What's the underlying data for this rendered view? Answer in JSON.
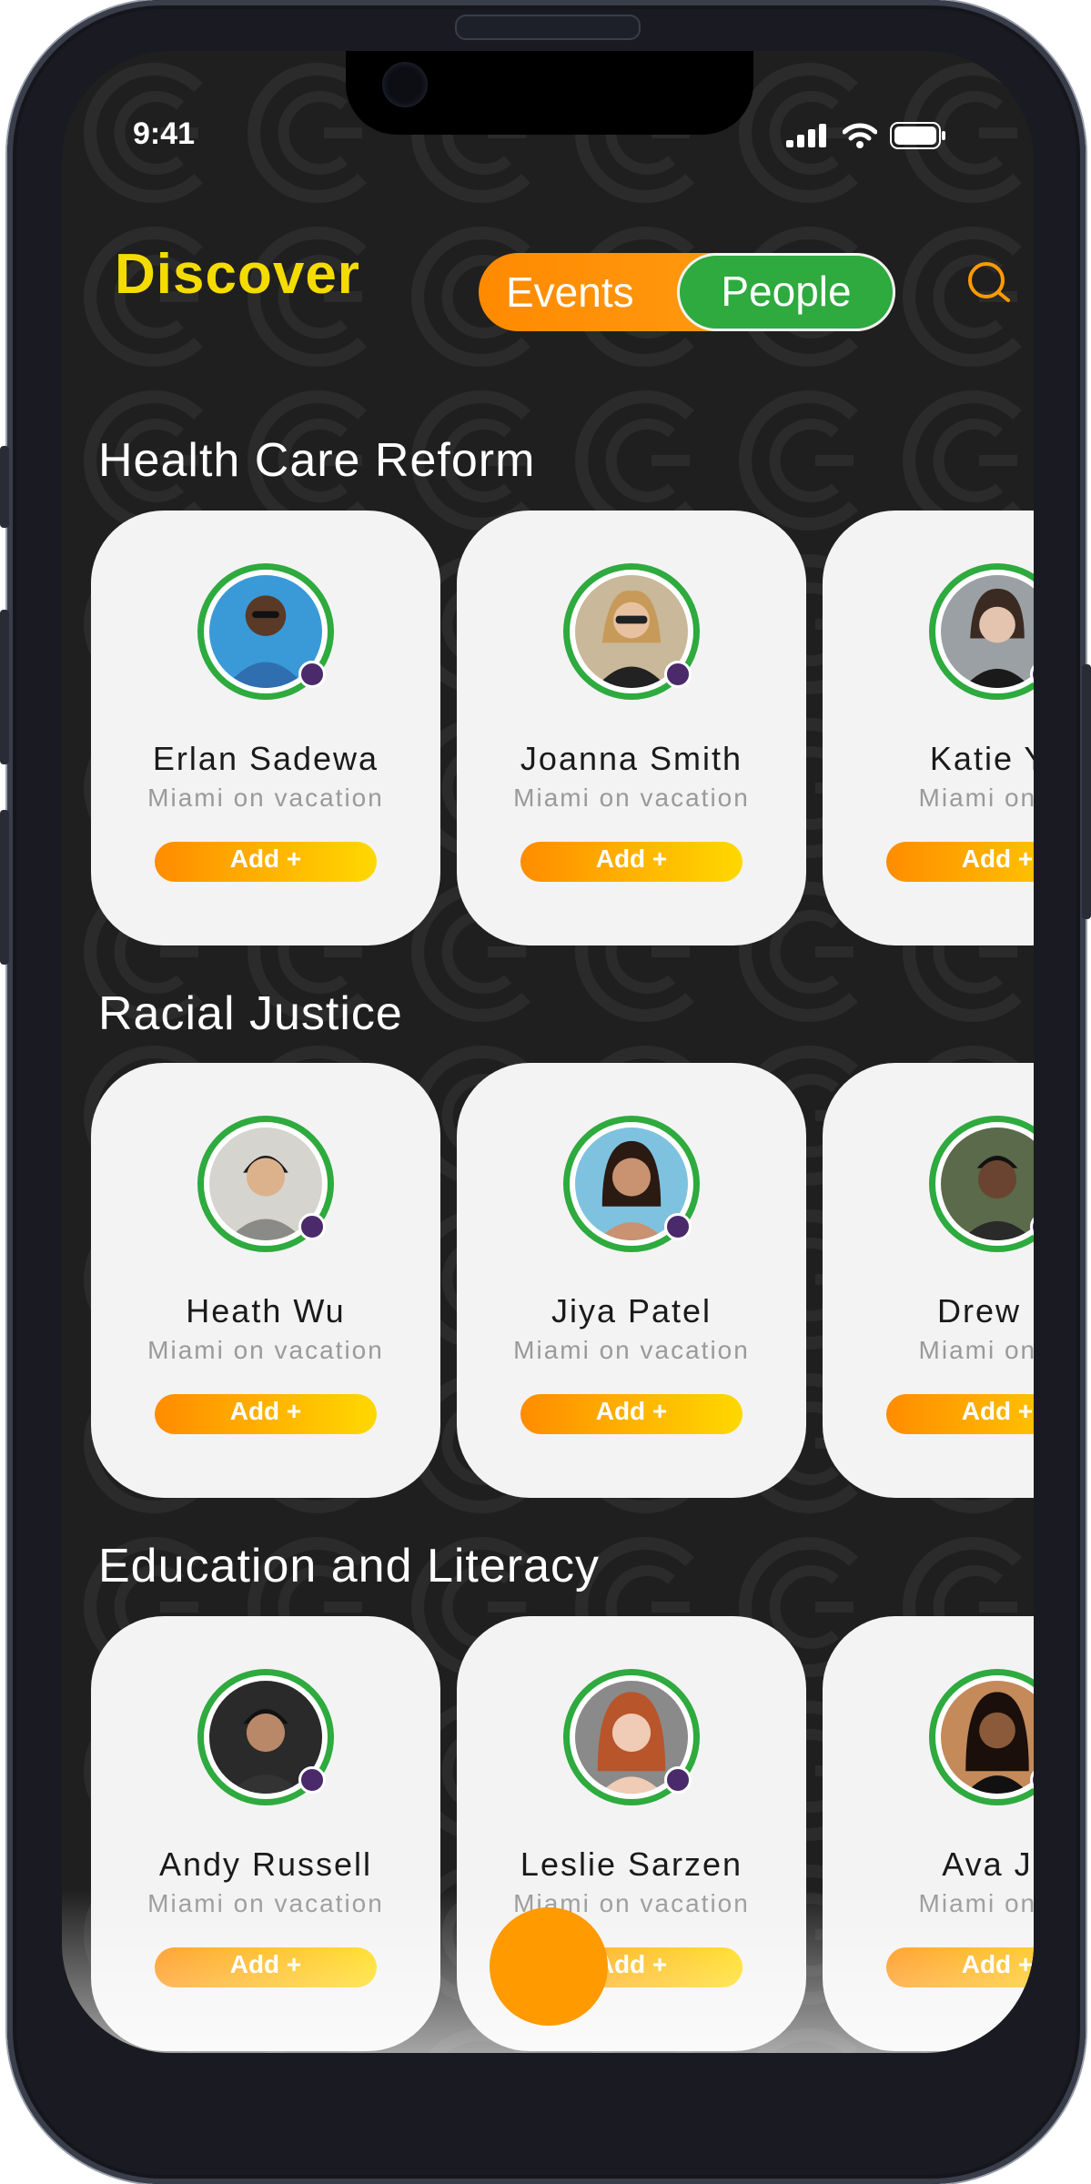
{
  "status": {
    "time": "9:41"
  },
  "header": {
    "title": "Discover",
    "tabs": [
      {
        "label": "Events",
        "active": false
      },
      {
        "label": "People",
        "active": true
      }
    ]
  },
  "sections": [
    {
      "title": "Health Care Reform",
      "people": [
        {
          "name": "Erlan Sadewa",
          "location": "Miami on vacation",
          "action": "Add +"
        },
        {
          "name": "Joanna Smith",
          "location": "Miami on vacation",
          "action": "Add +"
        },
        {
          "name": "Katie Yo",
          "location": "Miami on va",
          "action": "Add +"
        }
      ]
    },
    {
      "title": "Racial Justice",
      "people": [
        {
          "name": "Heath Wu",
          "location": "Miami on vacation",
          "action": "Add +"
        },
        {
          "name": "Jiya Patel",
          "location": "Miami on vacation",
          "action": "Add +"
        },
        {
          "name": "Drew R",
          "location": "Miami on va",
          "action": "Add +"
        }
      ]
    },
    {
      "title": "Education and Literacy",
      "people": [
        {
          "name": "Andy Russell",
          "location": "Miami on vacation",
          "action": "Add +"
        },
        {
          "name": "Leslie Sarzen",
          "location": "Miami on vacation",
          "action": "Add +"
        },
        {
          "name": "Ava Jo",
          "location": "Miami on va",
          "action": "Add +"
        }
      ]
    }
  ],
  "colors": {
    "accent_yellow": "#f5dc00",
    "accent_orange": "#ff8a00",
    "active_green": "#2eaa3e",
    "card_bg": "#f3f3f3",
    "screen_bg": "#1f1f1f"
  },
  "icons": {
    "search": "search-icon",
    "verified": "verified-badge-icon",
    "fab": "plus-icon"
  }
}
